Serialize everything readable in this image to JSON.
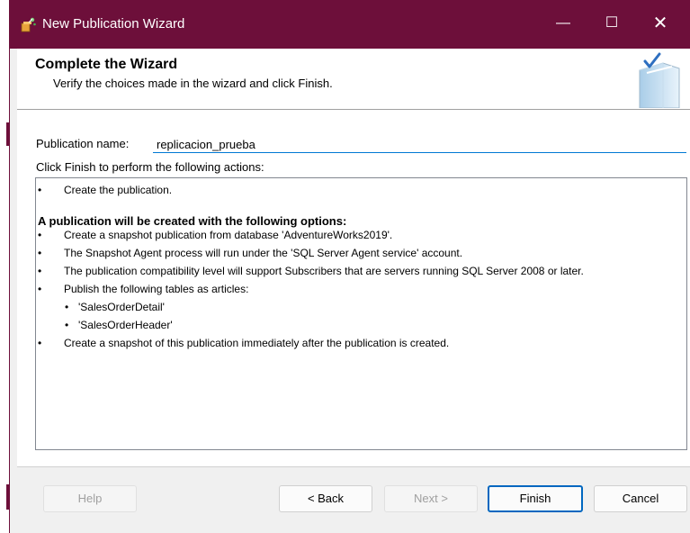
{
  "window": {
    "title": "New Publication Wizard",
    "minimize_glyph": "—",
    "maximize_glyph": "☐",
    "close_glyph": "✕",
    "titlebar_color": "#6d0f3a"
  },
  "header": {
    "title": "Complete the Wizard",
    "subtitle": "Verify the choices made in the wizard and click Finish."
  },
  "form": {
    "publication_name_label": "Publication name:",
    "publication_name_value": "replicacion_prueba",
    "instructions": "Click Finish to perform the following actions:"
  },
  "actions": {
    "bullet": "•",
    "first_action": "Create the publication.",
    "options_heading": "A publication will be created with the following options:",
    "options": [
      "Create a snapshot publication from database 'AdventureWorks2019'.",
      "The Snapshot Agent process will run under the 'SQL Server Agent service' account.",
      "The publication compatibility level will support Subscribers that are servers running SQL Server 2008 or later.",
      "Publish the following tables as articles:"
    ],
    "articles": [
      "'SalesOrderDetail'",
      "'SalesOrderHeader'"
    ],
    "last_action": "Create a snapshot of this publication immediately after the publication is created."
  },
  "buttons": {
    "help": "Help",
    "back": "< Back",
    "next": "Next >",
    "finish": "Finish",
    "cancel": "Cancel"
  },
  "icons": {
    "app": "wizard-app-icon",
    "header_graphic": "wizard-book-check-graphic"
  }
}
